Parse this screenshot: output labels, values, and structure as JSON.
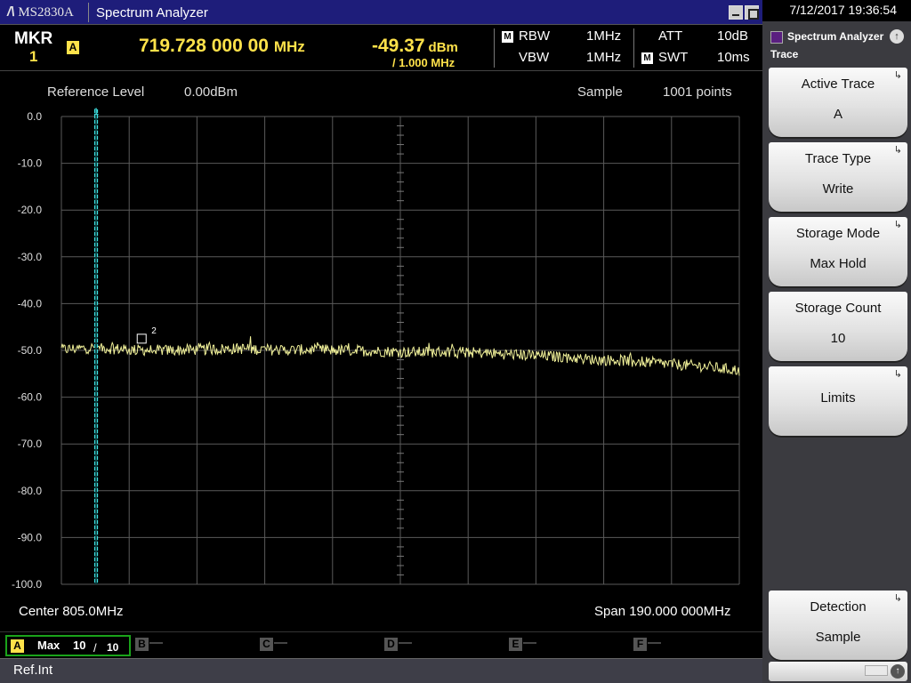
{
  "window": {
    "model": "MS2830A",
    "title": "Spectrum Analyzer"
  },
  "clock": "7/12/2017 19:36:54",
  "marker": {
    "label": "MKR",
    "number": "1",
    "trace": "A",
    "frequency": "719.728 000 00",
    "frequency_unit": "MHz",
    "level": "-49.37",
    "level_unit": "dBm",
    "level_per": "/ 1.000 MHz"
  },
  "params": {
    "m_label": "M",
    "rbw_label": "RBW",
    "rbw_value": "1MHz",
    "vbw_label": "VBW",
    "vbw_value": "1MHz",
    "att_label": "ATT",
    "att_value": "10dB",
    "swt_label": "SWT",
    "swt_value": "10ms"
  },
  "graph": {
    "reference_label": "Reference Level",
    "reference_value": "0.00dBm",
    "detector": "Sample",
    "points": "1001 points",
    "center": "Center 805.0MHz",
    "span": "Span 190.000 000MHz",
    "marker1_tag": "1",
    "marker2_tag": "2"
  },
  "chart_data": {
    "type": "line",
    "title": "",
    "xlabel": "",
    "ylabel": "",
    "x_unit": "MHz",
    "y_unit": "dBm",
    "xlim": [
      710.0,
      900.0
    ],
    "ylim": [
      -100.0,
      0.0
    ],
    "y_ticks": [
      "0.0",
      "-10.0",
      "-20.0",
      "-30.0",
      "-40.0",
      "-50.0",
      "-60.0",
      "-70.0",
      "-80.0",
      "-90.0",
      "-100.0"
    ],
    "grid": true,
    "series": [
      {
        "color": "#f2f29a",
        "x": [
          710,
          719.73,
          730,
          740,
          750,
          760,
          770,
          780,
          790,
          800,
          810,
          820,
          830,
          840,
          850,
          860,
          870,
          880,
          890,
          900
        ],
        "y": [
          -49.8,
          -49.4,
          -49.9,
          -50.0,
          -49.8,
          -49.6,
          -49.9,
          -49.9,
          -50.0,
          -50.2,
          -50.4,
          -50.3,
          -50.6,
          -51.0,
          -51.4,
          -52.0,
          -52.2,
          -52.9,
          -53.4,
          -54.3
        ]
      }
    ],
    "markers": [
      {
        "id": "1",
        "x": 719.73,
        "y": -49.37
      },
      {
        "id": "2",
        "x": 732.5,
        "y": -47.5
      }
    ]
  },
  "traces": {
    "active_letter": "A",
    "active_mode": "Max",
    "count": "10",
    "count_sep": "/",
    "count_total": "10",
    "others": [
      "B",
      "C",
      "D",
      "E",
      "F"
    ],
    "dash": "—"
  },
  "status": "Ref.Int",
  "panel": {
    "title": "Spectrum Analyzer",
    "subtitle": "Trace",
    "up_icon": "↑",
    "keys": [
      {
        "line1": "Active Trace",
        "line2": "A"
      },
      {
        "line1": "Trace Type",
        "line2": "Write"
      },
      {
        "line1": "Storage Mode",
        "line2": "Max Hold"
      },
      {
        "line1": "Storage Count",
        "line2": "10"
      },
      {
        "line1": "Limits",
        "line2": ""
      }
    ],
    "detection": {
      "line1": "Detection",
      "line2": "Sample"
    },
    "arrow": "↳"
  }
}
